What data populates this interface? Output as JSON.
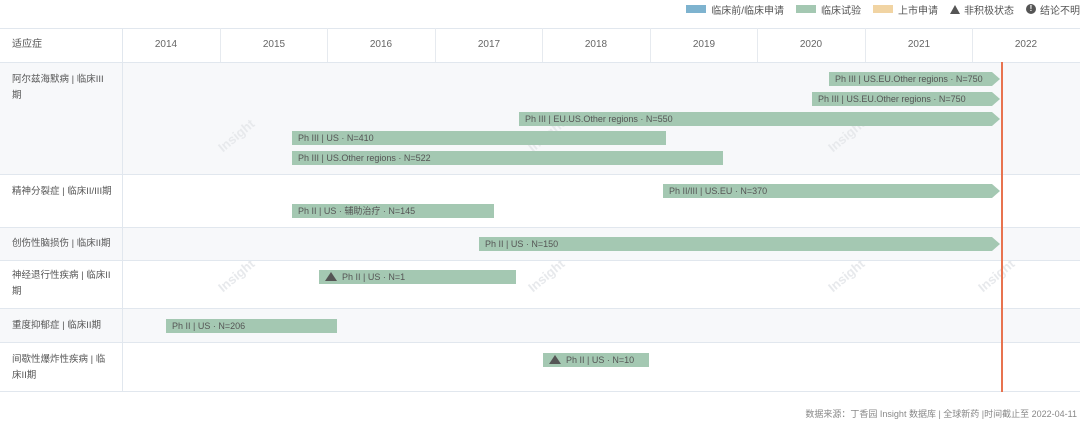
{
  "legend": {
    "items": [
      {
        "label": "临床前/临床申请",
        "color": "#7eb3cf"
      },
      {
        "label": "临床试验",
        "color": "#a4c8b2"
      },
      {
        "label": "上市申请",
        "color": "#f1d4a3"
      },
      {
        "label": "非积极状态",
        "icon": "triangle-icon"
      },
      {
        "label": "结论不明",
        "icon": "info-icon"
      }
    ]
  },
  "header": {
    "indication_label": "适应症",
    "years": [
      "2014",
      "2015",
      "2016",
      "2017",
      "2018",
      "2019",
      "2020",
      "2021",
      "2022"
    ]
  },
  "rows": [
    {
      "label": "阿尔兹海默病 | 临床III期",
      "bars": [
        {
          "text": "Ph III | US.EU.Other regions · N=750"
        },
        {
          "text": "Ph III | US.EU.Other regions · N=750"
        },
        {
          "text": "Ph III | EU.US.Other regions · N=550"
        },
        {
          "text": "Ph III | US · N=410"
        },
        {
          "text": "Ph III | US.Other regions · N=522"
        }
      ]
    },
    {
      "label": "精神分裂症 | 临床II/III期",
      "bars": [
        {
          "text": "Ph II/III | US.EU · N=370"
        },
        {
          "text": "Ph II | US · 辅助治疗 · N=145"
        }
      ]
    },
    {
      "label": "创伤性脑损伤 | 临床II期",
      "bars": [
        {
          "text": "Ph II | US · N=150"
        }
      ]
    },
    {
      "label": "神经退行性疾病 | 临床II期",
      "bars": [
        {
          "text": "Ph II | US · N=1"
        }
      ]
    },
    {
      "label": "重度抑郁症 | 临床II期",
      "bars": [
        {
          "text": "Ph II | US · N=206"
        }
      ]
    },
    {
      "label": "间歇性爆炸性疾病 | 临床II期",
      "bars": [
        {
          "text": "Ph II | US · N=10"
        }
      ]
    }
  ],
  "watermark": "Insight",
  "source": "数据来源：丁香园 Insight 数据库 | 全球新药 |时间截止至 2022-04-11"
}
